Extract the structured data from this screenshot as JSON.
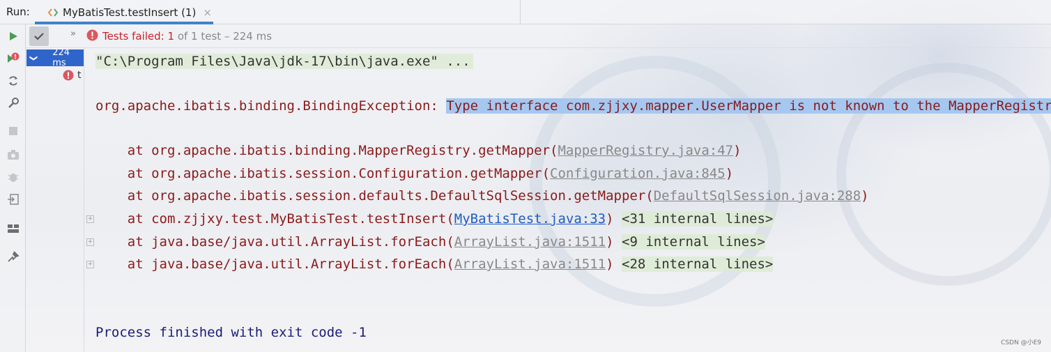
{
  "topbar": {
    "run_label": "Run:",
    "tab_title": "MyBatisTest.testInsert (1)",
    "close_glyph": "×"
  },
  "status": {
    "fail_text": "Tests failed: 1",
    "rest_text": " of 1 test – 224 ms",
    "chevron": "»"
  },
  "tree": {
    "root_time": "224 ms",
    "root_arrow": "❯",
    "child_label": "t"
  },
  "console": {
    "command": "\"C:\\Program Files\\Java\\jdk-17\\bin\\java.exe\" ...",
    "exception_prefix": "org.apache.ibatis.binding.BindingException: ",
    "exception_message": "Type interface com.zjjxy.mapper.UserMapper is not known to the MapperRegistry.",
    "stack": [
      {
        "prefix": "    at org.apache.ibatis.binding.MapperRegistry.getMapper(",
        "link": "MapperRegistry.java:47",
        "suffix": ")",
        "internal": "",
        "fold": false,
        "link_style": "gray"
      },
      {
        "prefix": "    at org.apache.ibatis.session.Configuration.getMapper(",
        "link": "Configuration.java:845",
        "suffix": ")",
        "internal": "",
        "fold": false,
        "link_style": "gray"
      },
      {
        "prefix": "    at org.apache.ibatis.session.defaults.DefaultSqlSession.getMapper(",
        "link": "DefaultSqlSession.java:288",
        "suffix": ")",
        "internal": "",
        "fold": false,
        "link_style": "gray"
      },
      {
        "prefix": "    at com.zjjxy.test.MyBatisTest.testInsert(",
        "link": "MyBatisTest.java:33",
        "suffix": ") ",
        "internal": "<31 internal lines>",
        "fold": true,
        "link_style": "blue"
      },
      {
        "prefix": "    at java.base/java.util.ArrayList.forEach(",
        "link": "ArrayList.java:1511",
        "suffix": ") ",
        "internal": "<9 internal lines>",
        "fold": true,
        "link_style": "gray"
      },
      {
        "prefix": "    at java.base/java.util.ArrayList.forEach(",
        "link": "ArrayList.java:1511",
        "suffix": ") ",
        "internal": "<28 internal lines>",
        "fold": true,
        "link_style": "gray"
      }
    ],
    "exit_line": "Process finished with exit code -1"
  },
  "watermark": "CSDN @小E9",
  "colors": {
    "accent": "#4083c9",
    "error": "#c7222d",
    "selection": "#a6c8f0",
    "stack_text": "#8b1a1a"
  }
}
